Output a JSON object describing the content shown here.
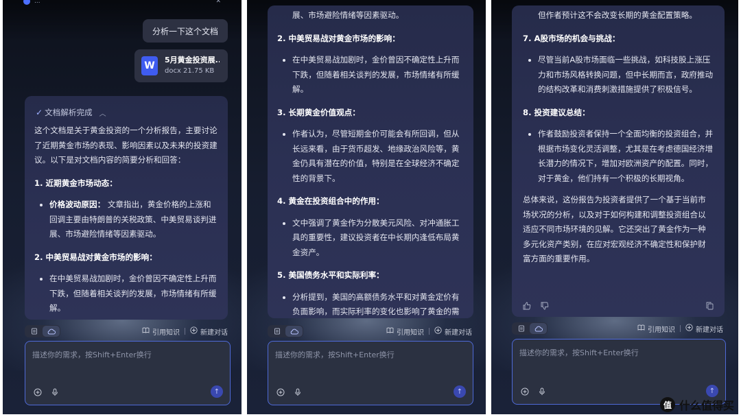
{
  "common": {
    "input_placeholder": "描述你的需求，按Shift+Enter换行",
    "cite_label": "引用知识",
    "new_chat_label": "新建对话"
  },
  "panel1": {
    "app_title": "...",
    "user_message": "分析一下这个文档",
    "file": {
      "name": "5月黄金投资展...",
      "meta": "docx 21.75 KB",
      "icon": "W"
    },
    "parse_status": "文档解析完成",
    "intro": "这个文档是关于黄金投资的一个分析报告，主要讨论了近期黄金市场的表现、影响因素以及未来的投资建议。以下是对文档内容的简要分析和回答：",
    "h1": "1. 近期黄金市场动态：",
    "b1_strong": "价格波动原因：",
    "b1_text": " 文章指出，黄金价格的上涨和回调主要由特朗普的关税政策、中美贸易谈判进展、市场避险情绪等因素驱动。",
    "h2": "2. 中美贸易战对黄金市场的影响：",
    "b2": "在中美贸易战加剧时，金价曾因不确定性上升而下跌，但随着相关谈判的发展，市场情绪有所缓解。"
  },
  "panel2": {
    "top_fragment": "展、市场避险情绪等因素驱动。",
    "h2": "2. 中美贸易战对黄金市场的影响：",
    "b2": "在中美贸易战加剧时，金价曾因不确定性上升而下跌，但随着相关谈判的发展，市场情绪有所缓解。",
    "h3": "3. 长期黄金价值观点：",
    "b3": "作者认为，尽管短期金价可能会有所回调，但从长远来看，由于货币超发、地缘政治风险等，黄金仍具有潜在的价值，特别是在全球经济不确定性的背景下。",
    "h4": "4. 黄金在投资组合中的作用：",
    "b4": "文中强调了黄金作为分散美元风险、对冲通胀工具的重要性，建议投资者在中长期内逢低布局黄金资产。",
    "h5": "5. 美国债务水平和实际利率：",
    "b5": "分析提到，美国的高额债务水平和对黄金定价有负面影响，而实际利率的变化也影响了黄金的需"
  },
  "panel3": {
    "top_fragment": "但作者预计这不会改变长期的黄金配置策略。",
    "h7": "7. A股市场的机会与挑战：",
    "b7": "尽管当前A股市场面临一些挑战，如科技股上涨压力和市场风格转换问题，但中长期而言，政府推动的结构改革和消费刺激措施提供了积极信号。",
    "h8": "8. 投资建议总结：",
    "b8": "作者鼓励投资者保持一个全面均衡的投资组合，并根据市场变化灵活调整，尤其是在考虑德国经济增长潜力的情况下，增加对欧洲资产的配置。同时，对于黄金，他们持有一个积极的长期视角。",
    "summary": "总体来说，这份报告为投资者提供了一个基于当前市场状况的分析，以及对于如何构建和调整投资组合以适应不同市场环境的见解。它还突出了黄金作为一种多元化资产类别，在应对宏观经济不确定性和保护财富方面的重要作用。"
  },
  "watermark": {
    "badge": "值",
    "text": "什么值得买"
  }
}
